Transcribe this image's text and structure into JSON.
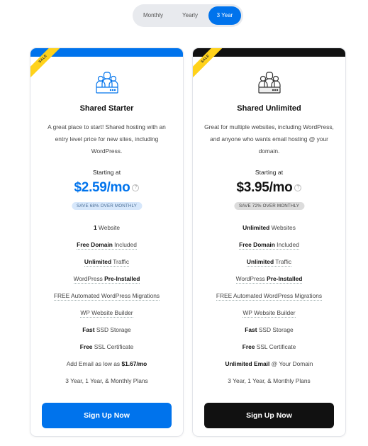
{
  "billing_toggle": {
    "options": [
      "Monthly",
      "Yearly",
      "3 Year"
    ],
    "selected": "3 Year"
  },
  "colors": {
    "accent_blue": "#0073ec",
    "dark": "#111111",
    "sale_ribbon": "#ffd21a"
  },
  "plans": [
    {
      "ribbon": "SALE",
      "icon": "users-server-icon",
      "name": "Shared Starter",
      "description": "A great place to start! Shared hosting with an entry level price for new sites, including WordPress.",
      "starting_label": "Starting at",
      "price": "$2.59/mo",
      "help_icon": "?",
      "save_badge": "SAVE 68% OVER MONTHLY",
      "features": [
        {
          "bold": "1",
          "text": " Website",
          "underlined": false
        },
        {
          "bold": "Free Domain",
          "text": " Included",
          "underlined": true
        },
        {
          "bold": "Unlimited",
          "text": " Traffic",
          "underlined": true
        },
        {
          "pre": "WordPress ",
          "bold": "Pre-Installed",
          "underlined": true
        },
        {
          "pre": "FREE Automated WordPress Migrations",
          "underlined": true
        },
        {
          "pre": "WP Website Builder",
          "underlined": true
        },
        {
          "bold": "Fast",
          "text": " SSD Storage",
          "underlined": false
        },
        {
          "bold": "Free",
          "text": " SSL Certificate",
          "underlined": false
        },
        {
          "pre": "Add Email as low as ",
          "bold": "$1.67/mo",
          "underlined": false
        },
        {
          "pre": "3 Year, 1 Year, & Monthly Plans",
          "underlined": false
        }
      ],
      "button_label": "Sign Up Now"
    },
    {
      "ribbon": "SALE",
      "icon": "users-server-icon",
      "name": "Shared Unlimited",
      "description": "Great for multiple websites, including WordPress, and anyone who wants email hosting @ your domain.",
      "starting_label": "Starting at",
      "price": "$3.95/mo",
      "help_icon": "?",
      "save_badge": "SAVE 72% OVER MONTHLY",
      "features": [
        {
          "bold": "Unlimited",
          "text": " Websites",
          "underlined": false
        },
        {
          "bold": "Free Domain",
          "text": " Included",
          "underlined": true
        },
        {
          "bold": "Unlimited",
          "text": " Traffic",
          "underlined": true
        },
        {
          "pre": "WordPress ",
          "bold": "Pre-Installed",
          "underlined": true
        },
        {
          "pre": "FREE Automated WordPress Migrations",
          "underlined": true
        },
        {
          "pre": "WP Website Builder",
          "underlined": true
        },
        {
          "bold": "Fast",
          "text": " SSD Storage",
          "underlined": false
        },
        {
          "bold": "Free",
          "text": " SSL Certificate",
          "underlined": false
        },
        {
          "bold": "Unlimited Email",
          "text": " @ Your Domain",
          "underlined": false
        },
        {
          "pre": "3 Year, 1 Year, & Monthly Plans",
          "underlined": false
        }
      ],
      "button_label": "Sign Up Now"
    }
  ]
}
